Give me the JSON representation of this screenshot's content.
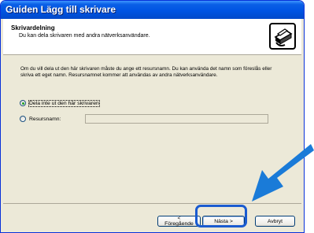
{
  "window": {
    "title": "Guiden Lägg till skrivare",
    "header_title": "Skrivardelning",
    "header_subtitle": "Du kan dela skrivaren med andra nätverksanvändare."
  },
  "content": {
    "description": "Om du vill dela ut den här skrivaren måste du ange ett resursnamn. Du kan använda det namn som föreslås eller skriva ett eget namn. Resursnamnet kommer att användas av andra nätverksanvändare.",
    "option_no_share": "Dela inte ut den här skrivaren",
    "option_share": "Resursnamn:",
    "selected_option": "option_no_share",
    "share_name_value": ""
  },
  "buttons": {
    "back": "< Föregående",
    "next": "Nästa >",
    "cancel": "Avbryt"
  },
  "colors": {
    "titlebar": "#0054e3",
    "highlight": "#1a5bd0",
    "arrow": "#1a7bd8"
  }
}
